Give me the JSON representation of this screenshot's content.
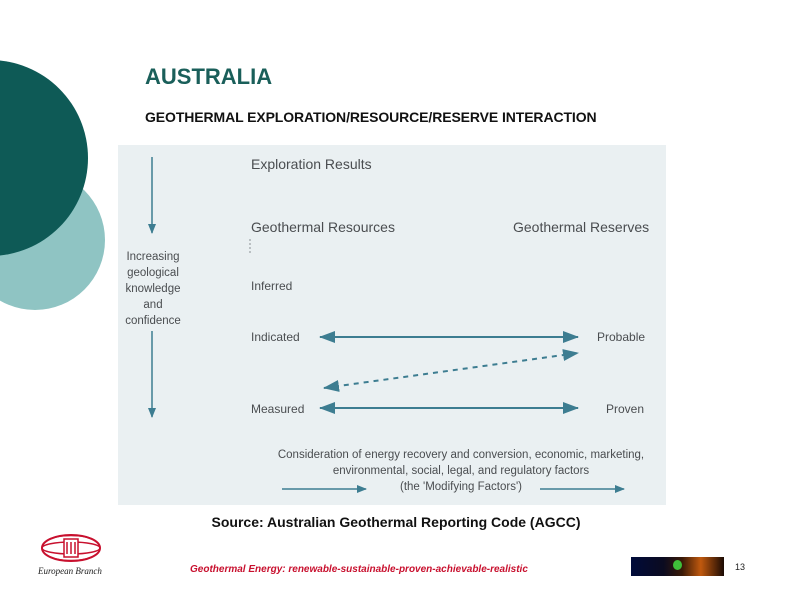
{
  "title": "AUSTRALIA",
  "subtitle": "GEOTHERMAL EXPLORATION/RESOURCE/RESERVE INTERACTION",
  "diagram": {
    "exploration_results": "Exploration Results",
    "geothermal_resources": "Geothermal Resources",
    "geothermal_reserves": "Geothermal Reserves",
    "knowledge_lines": [
      "Increasing",
      "geological",
      "knowledge",
      "and",
      "confidence"
    ],
    "inferred": "Inferred",
    "indicated": "Indicated",
    "measured": "Measured",
    "probable": "Probable",
    "proven": "Proven",
    "modifying_lines": [
      "Consideration of energy recovery and conversion, economic, marketing,",
      "environmental, social, legal, and regulatory factors",
      "(the 'Modifying Factors')"
    ]
  },
  "source": "Source: Australian Geothermal Reporting Code (AGCC)",
  "footer": {
    "branch": "European Branch",
    "tagline": "Geothermal Energy: renewable-sustainable-proven-achievable-realistic",
    "page_number": "13"
  },
  "colors": {
    "title": "#1a5f5a",
    "deco_dark": "#0e5a56",
    "deco_light": "#8fc4c3",
    "arrow": "#3d7d91",
    "panel": "#eaf0f2",
    "tagline": "#c8102e"
  }
}
